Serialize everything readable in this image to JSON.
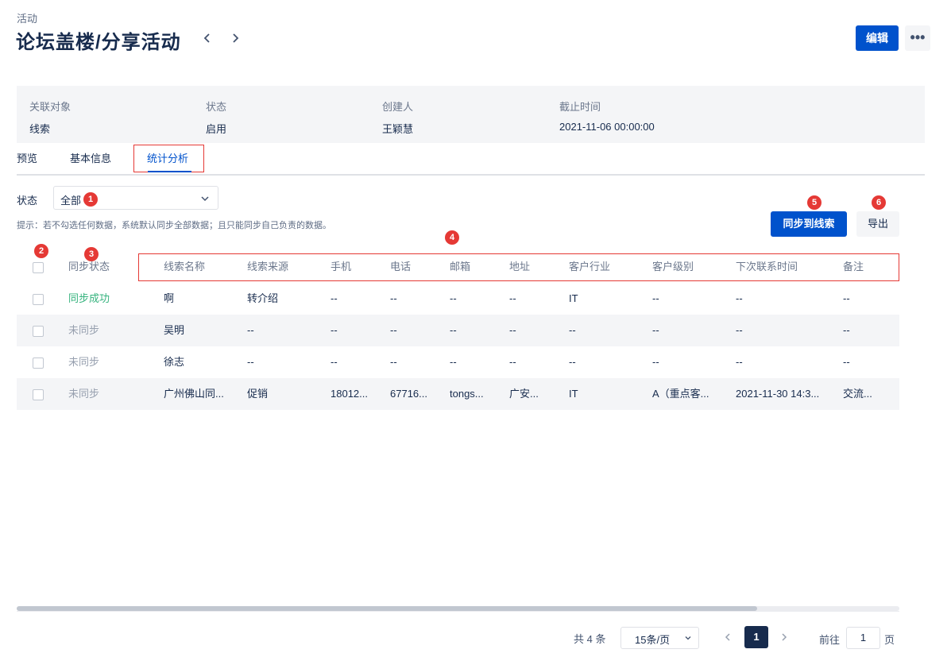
{
  "breadcrumb": "活动",
  "title": "论坛盖楼/分享活动",
  "actions": {
    "edit": "编辑",
    "more": "•••"
  },
  "info": [
    {
      "label": "关联对象",
      "value": "线索"
    },
    {
      "label": "状态",
      "value": "启用"
    },
    {
      "label": "创建人",
      "value": "王颖慧"
    },
    {
      "label": "截止时间",
      "value": "2021-11-06 00:00:00"
    }
  ],
  "tabs": [
    {
      "label": "预览"
    },
    {
      "label": "基本信息"
    },
    {
      "label": "统计分析",
      "active": true
    }
  ],
  "filter": {
    "label": "状态",
    "value": "全部"
  },
  "hint": "提示：若不勾选任何数据，系统默认同步全部数据；且只能同步自己负责的数据。",
  "buttons": {
    "sync": "同步到线索",
    "export": "导出"
  },
  "badges": [
    "1",
    "2",
    "3",
    "4",
    "5",
    "6"
  ],
  "table": {
    "headers": [
      "同步状态",
      "线索名称",
      "线索来源",
      "手机",
      "电话",
      "邮箱",
      "地址",
      "客户行业",
      "客户级别",
      "下次联系时间",
      "备注"
    ],
    "rows": [
      [
        "同步成功",
        "啊",
        "转介绍",
        "--",
        "--",
        "--",
        "--",
        "IT",
        "--",
        "--",
        "--"
      ],
      [
        "未同步",
        "吴明",
        "--",
        "--",
        "--",
        "--",
        "--",
        "--",
        "--",
        "--",
        "--"
      ],
      [
        "未同步",
        "徐志",
        "--",
        "--",
        "--",
        "--",
        "--",
        "--",
        "--",
        "--",
        "--"
      ],
      [
        "未同步",
        "广州佛山同...",
        "促销",
        "18012...",
        "67716...",
        "tongs...",
        "广安...",
        "IT",
        "A（重点客...",
        "2021-11-30 14:3...",
        "交流..."
      ]
    ],
    "status_colors": {
      "同步成功": "#36b37e",
      "未同步": "#97a0af"
    }
  },
  "pagination": {
    "total": "共 4 条",
    "page_size": "15条/页",
    "current": "1",
    "goto_label": "前往",
    "goto_value": "1",
    "unit": "页"
  },
  "colors": {
    "primary": "#0052cc",
    "annotation": "#e53935",
    "text": "#172b4d"
  }
}
